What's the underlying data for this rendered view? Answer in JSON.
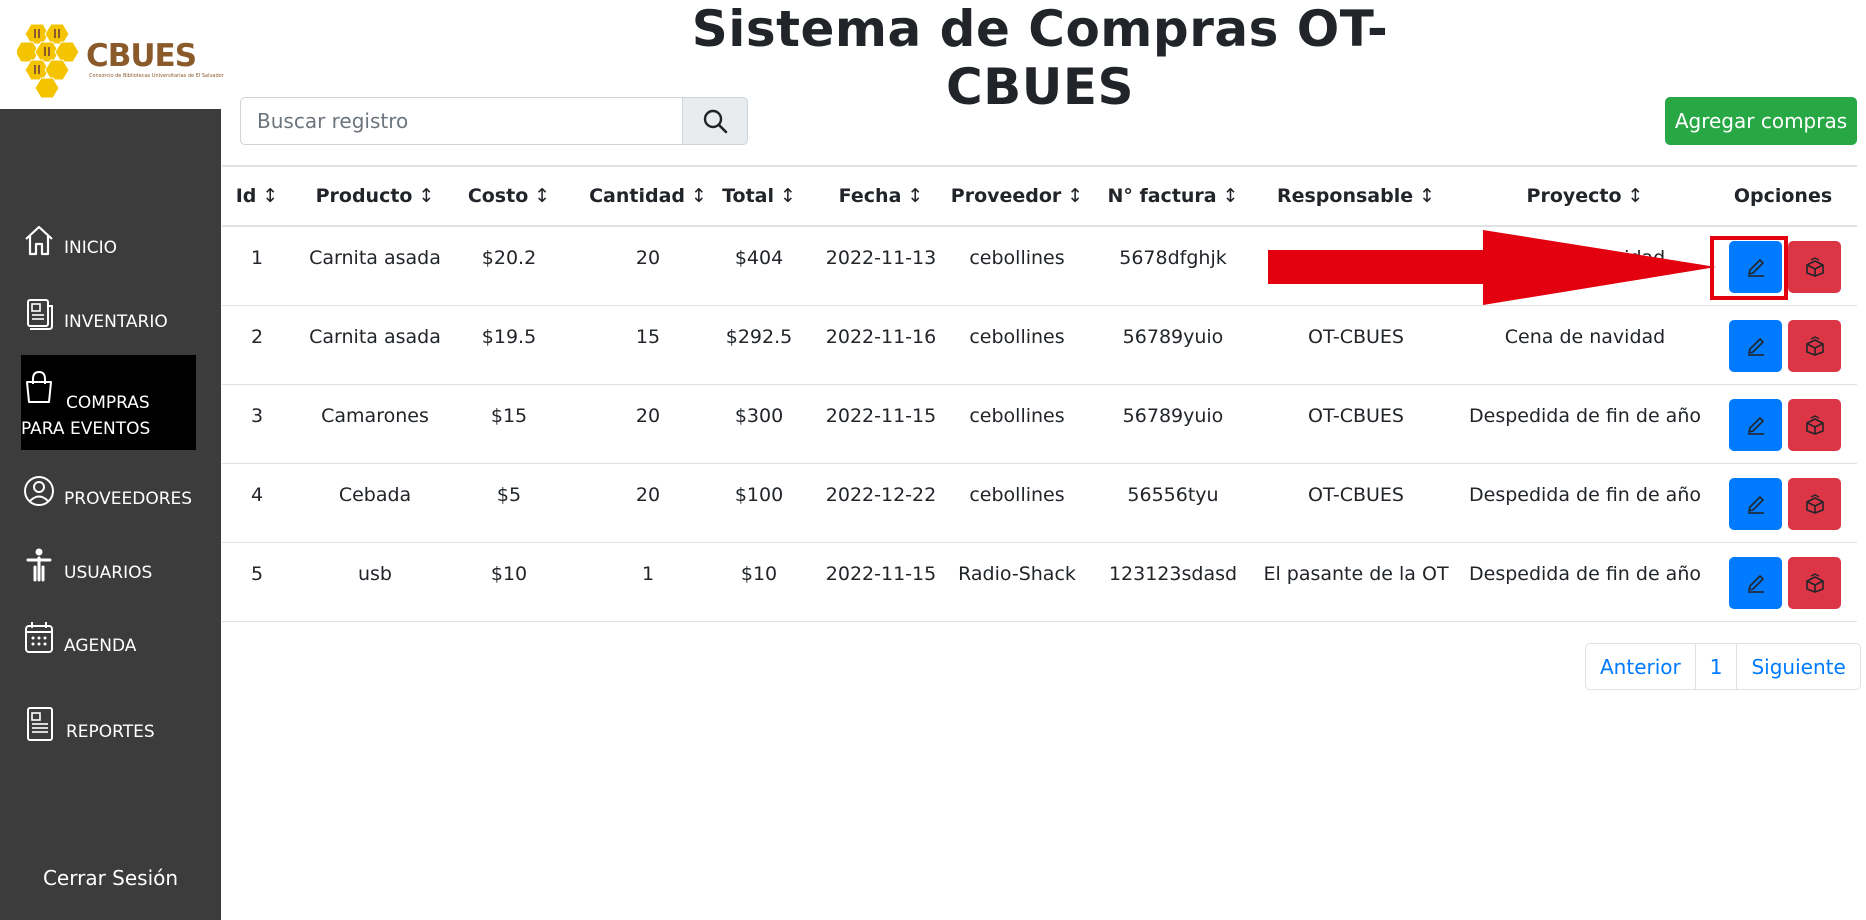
{
  "logo": {
    "text": "CBUES",
    "subtitle": "Consorcio de Bibliotecas Universitarias de El Salvador"
  },
  "title": "Sistema de Compras OT-CBUES",
  "sidebar": {
    "items": [
      {
        "label": "INICIO",
        "icon": "home-icon"
      },
      {
        "label": "INVENTARIO",
        "icon": "newspaper-icon"
      },
      {
        "label": "COMPRAS PARA EVENTOS",
        "icon": "shopping-bag-icon",
        "active": true
      },
      {
        "label": "PROVEEDORES",
        "icon": "person-circle-icon"
      },
      {
        "label": "USUARIOS",
        "icon": "person-icon"
      },
      {
        "label": "AGENDA",
        "icon": "calendar-icon"
      },
      {
        "label": "REPORTES",
        "icon": "report-icon"
      }
    ],
    "logout": "Cerrar Sesión"
  },
  "search": {
    "placeholder": "Buscar registro"
  },
  "add_button": "Agregar compras",
  "table": {
    "headers": [
      "Id",
      "Producto",
      "Costo",
      "Cantidad",
      "Total",
      "Fecha",
      "Proveedor",
      "N° factura",
      "Responsable",
      "Proyecto",
      "Opciones"
    ],
    "sort_glyph": "↕",
    "rows": [
      [
        "1",
        "Carnita asada",
        "$20.2",
        "20",
        "$404",
        "2022-11-13",
        "cebollines",
        "5678dfghjk",
        "",
        "Cena de navidad"
      ],
      [
        "2",
        "Carnita asada",
        "$19.5",
        "15",
        "$292.5",
        "2022-11-16",
        "cebollines",
        "56789yuio",
        "OT-CBUES",
        "Cena de navidad"
      ],
      [
        "3",
        "Camarones",
        "$15",
        "20",
        "$300",
        "2022-11-15",
        "cebollines",
        "56789yuio",
        "OT-CBUES",
        "Despedida de fin de año"
      ],
      [
        "4",
        "Cebada",
        "$5",
        "20",
        "$100",
        "2022-12-22",
        "cebollines",
        "56556tyu",
        "OT-CBUES",
        "Despedida de fin de año"
      ],
      [
        "5",
        "usb",
        "$10",
        "1",
        "$10",
        "2022-11-15",
        "Radio-Shack",
        "123123sdasd",
        "El pasante de la OT",
        "Despedida de fin de año"
      ]
    ]
  },
  "pagination": {
    "prev": "Anterior",
    "page": "1",
    "next": "Siguiente"
  },
  "colors": {
    "sidebar": "#3c3c3c",
    "edit": "#007bff",
    "delete": "#dc3545",
    "add": "#28a745",
    "annotation": "#e3000f"
  }
}
